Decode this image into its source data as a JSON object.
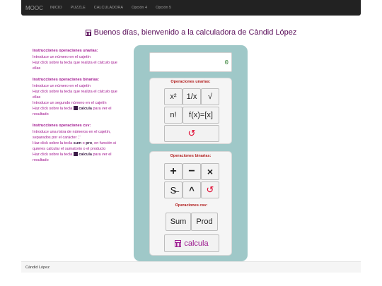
{
  "navbar": {
    "brand": "MOOC",
    "items": [
      "INICIO",
      "PUZZLE",
      "CALCULADORA",
      "Opción 4",
      "Opción 5"
    ]
  },
  "page_title": "Buenos días, bienvenido a la calculadora de Càndid López",
  "instructions": {
    "unary": {
      "heading": "Instrucciones operaciones unarias:",
      "lines": [
        "Introduce un número en el cajetín",
        "Haz click sobre la tecla que realiza el cálculo que ellas"
      ]
    },
    "binary": {
      "heading": "Instrucciones operaciones binarias:",
      "lines": [
        "Introduce un número en el cajetín",
        "Haz click sobre la tecla que realiza el cálculo que ellas",
        "Introduce un segundo número en el cajetín"
      ],
      "last_prefix": "Haz click sobre la tecla",
      "last_bold": "calcula",
      "last_suffix": "para ver el resultado"
    },
    "csv": {
      "heading": "Instrucciones operaciones csv:",
      "line1": "Introduce una ristra de números en el cajetín, separados por el carácter ','",
      "line2_prefix": "Haz click sobre la tecla",
      "line2_sum": "sum",
      "line2_mid": "o",
      "line2_prod": "pro",
      "line2_suffix": ", en función si quieres calcular el sumatorio o el producto",
      "line3_prefix": "Haz click sobre la tecla",
      "line3_bold": "calcula",
      "line3_suffix": "para ver el resultado"
    }
  },
  "calculator": {
    "display_value": "0",
    "unary_panel": {
      "heading": "Operaciones unarias:",
      "buttons": [
        "x²",
        "1/x",
        "√",
        "n!",
        "f(x)=[x]",
        "↺"
      ]
    },
    "binary_panel": {
      "heading": "Operaciones binarias:",
      "buttons": [
        "+",
        "−",
        "×",
        "S̶",
        "^",
        "↺"
      ]
    },
    "csv_panel": {
      "heading": "Operaciones csv:",
      "sum_label": "Sum",
      "prod_label": "Prod"
    },
    "calcula_label": "calcula"
  },
  "footer": {
    "author": "Càndid López"
  },
  "colors": {
    "navbar_bg": "#222222",
    "title": "#5b0f5b",
    "instruction_text": "#a0138e",
    "calculator_bg": "#9fc8c8",
    "reset_red": "#e0002a"
  }
}
